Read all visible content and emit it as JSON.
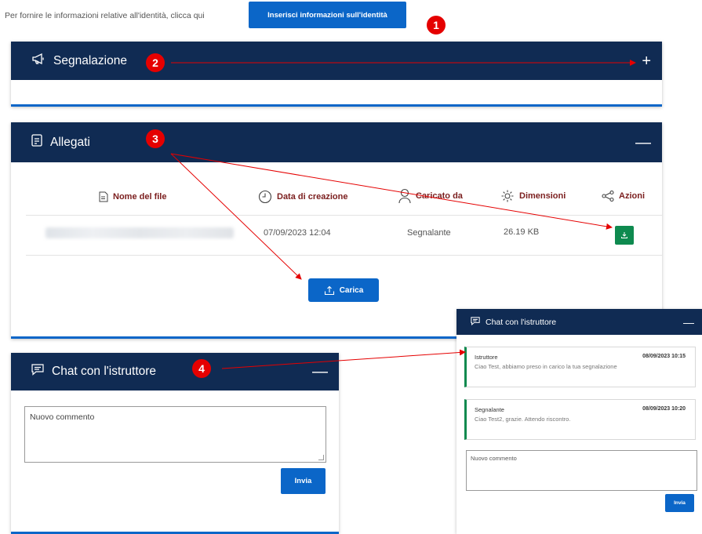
{
  "identity": {
    "prompt_text": "Per fornire le informazioni relative all'identità, clicca qui",
    "button_label": "Inserisci informazioni sull'identità"
  },
  "segnalazione_panel": {
    "title": "Segnalazione",
    "toggle": "+"
  },
  "allegati_panel": {
    "title": "Allegati",
    "toggle": "—",
    "columns": [
      "Nome del file",
      "Data di creazione",
      "Caricato da",
      "Dimensioni",
      "Azioni"
    ],
    "rows": [
      {
        "file_name": "",
        "created": "07/09/2023 12:04",
        "uploaded_by": "Segnalante",
        "size": "26.19 KB",
        "action_icon": "download-icon"
      }
    ],
    "upload_button": "Carica"
  },
  "chat_panel": {
    "title": "Chat con l'istruttore",
    "toggle": "—",
    "comment_placeholder": "Nuovo commento",
    "send_button": "Invia"
  },
  "chat_inset": {
    "title": "Chat con l'istruttore",
    "toggle": "—",
    "messages": [
      {
        "author": "Istruttore",
        "date": "08/09/2023 10:15",
        "text": "Ciao Test, abbiamo preso in carico la tua segnalazione"
      },
      {
        "author": "Segnalante",
        "date": "08/09/2023 10:20",
        "text": "Ciao Test2, grazie. Attendo riscontro."
      }
    ],
    "comment_placeholder": "Nuovo commento",
    "send_button": "Invia"
  },
  "annotations": [
    "1",
    "2",
    "3",
    "4"
  ],
  "colors": {
    "header": "#102b53",
    "primary": "#0b66c8",
    "success": "#0e8a4f",
    "annotation": "#e50000",
    "column_header": "#7b1e1e"
  }
}
